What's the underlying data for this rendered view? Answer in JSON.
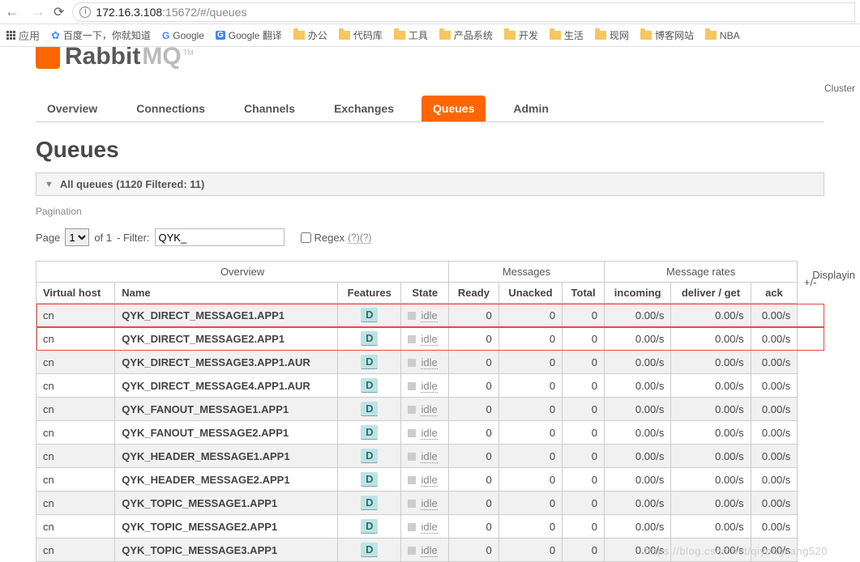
{
  "browser": {
    "url_host": "172.16.3.108",
    "url_port_path": ":15672/#/queues",
    "apps": "应用",
    "bookmarks": [
      {
        "label": "百度一下，你就知道",
        "icon": "paw"
      },
      {
        "label": "Google",
        "icon": "g"
      },
      {
        "label": "Google 翻译",
        "icon": "gt"
      },
      {
        "label": "办公",
        "icon": "folder"
      },
      {
        "label": "代码库",
        "icon": "folder"
      },
      {
        "label": "工具",
        "icon": "folder"
      },
      {
        "label": "产品系统",
        "icon": "folder"
      },
      {
        "label": "开发",
        "icon": "folder"
      },
      {
        "label": "生活",
        "icon": "folder"
      },
      {
        "label": "现网",
        "icon": "folder"
      },
      {
        "label": "博客网站",
        "icon": "folder"
      },
      {
        "label": "NBA",
        "icon": "folder"
      }
    ]
  },
  "logo": {
    "part1": "Rabbit",
    "part2": "MQ",
    "tm": "TM"
  },
  "cluster_label": "Cluster",
  "nav": {
    "items": [
      "Overview",
      "Connections",
      "Channels",
      "Exchanges",
      "Queues",
      "Admin"
    ],
    "active": "Queues"
  },
  "page_title": "Queues",
  "section_header": "All queues (1120 Filtered: 11)",
  "pagination_label": "Pagination",
  "pager": {
    "page_label": "Page",
    "page_value": "1",
    "of_label": "of 1",
    "filter_label": "- Filter:",
    "filter_value": "QYK_",
    "regex_label": "Regex",
    "regex_hint": "(?)(?)"
  },
  "displaying": "Displayin",
  "table": {
    "groups": [
      {
        "label": "Overview",
        "span": 4
      },
      {
        "label": "Messages",
        "span": 3
      },
      {
        "label": "Message rates",
        "span": 3
      }
    ],
    "plus_minus": "+/-",
    "cols": [
      "Virtual host",
      "Name",
      "Features",
      "State",
      "Ready",
      "Unacked",
      "Total",
      "incoming",
      "deliver / get",
      "ack"
    ],
    "feature_badge": "D",
    "state_text": "idle",
    "rows": [
      {
        "vh": "cn",
        "name": "QYK_DIRECT_MESSAGE1.APP1",
        "ready": "0",
        "unacked": "0",
        "total": "0",
        "in": "0.00/s",
        "dg": "0.00/s",
        "ack": "0.00/s",
        "hl": true
      },
      {
        "vh": "cn",
        "name": "QYK_DIRECT_MESSAGE2.APP1",
        "ready": "0",
        "unacked": "0",
        "total": "0",
        "in": "0.00/s",
        "dg": "0.00/s",
        "ack": "0.00/s",
        "hl": true
      },
      {
        "vh": "cn",
        "name": "QYK_DIRECT_MESSAGE3.APP1.AUR",
        "ready": "0",
        "unacked": "0",
        "total": "0",
        "in": "0.00/s",
        "dg": "0.00/s",
        "ack": "0.00/s"
      },
      {
        "vh": "cn",
        "name": "QYK_DIRECT_MESSAGE4.APP1.AUR",
        "ready": "0",
        "unacked": "0",
        "total": "0",
        "in": "0.00/s",
        "dg": "0.00/s",
        "ack": "0.00/s"
      },
      {
        "vh": "cn",
        "name": "QYK_FANOUT_MESSAGE1.APP1",
        "ready": "0",
        "unacked": "0",
        "total": "0",
        "in": "0.00/s",
        "dg": "0.00/s",
        "ack": "0.00/s"
      },
      {
        "vh": "cn",
        "name": "QYK_FANOUT_MESSAGE2.APP1",
        "ready": "0",
        "unacked": "0",
        "total": "0",
        "in": "0.00/s",
        "dg": "0.00/s",
        "ack": "0.00/s"
      },
      {
        "vh": "cn",
        "name": "QYK_HEADER_MESSAGE1.APP1",
        "ready": "0",
        "unacked": "0",
        "total": "0",
        "in": "0.00/s",
        "dg": "0.00/s",
        "ack": "0.00/s"
      },
      {
        "vh": "cn",
        "name": "QYK_HEADER_MESSAGE2.APP1",
        "ready": "0",
        "unacked": "0",
        "total": "0",
        "in": "0.00/s",
        "dg": "0.00/s",
        "ack": "0.00/s"
      },
      {
        "vh": "cn",
        "name": "QYK_TOPIC_MESSAGE1.APP1",
        "ready": "0",
        "unacked": "0",
        "total": "0",
        "in": "0.00/s",
        "dg": "0.00/s",
        "ack": "0.00/s"
      },
      {
        "vh": "cn",
        "name": "QYK_TOPIC_MESSAGE2.APP1",
        "ready": "0",
        "unacked": "0",
        "total": "0",
        "in": "0.00/s",
        "dg": "0.00/s",
        "ack": "0.00/s"
      },
      {
        "vh": "cn",
        "name": "QYK_TOPIC_MESSAGE3.APP1",
        "ready": "0",
        "unacked": "0",
        "total": "0",
        "in": "0.00/s",
        "dg": "0.00/s",
        "ack": "0.00/s"
      }
    ]
  },
  "watermark": "https://blog.csdn.net/qiyongkang520"
}
